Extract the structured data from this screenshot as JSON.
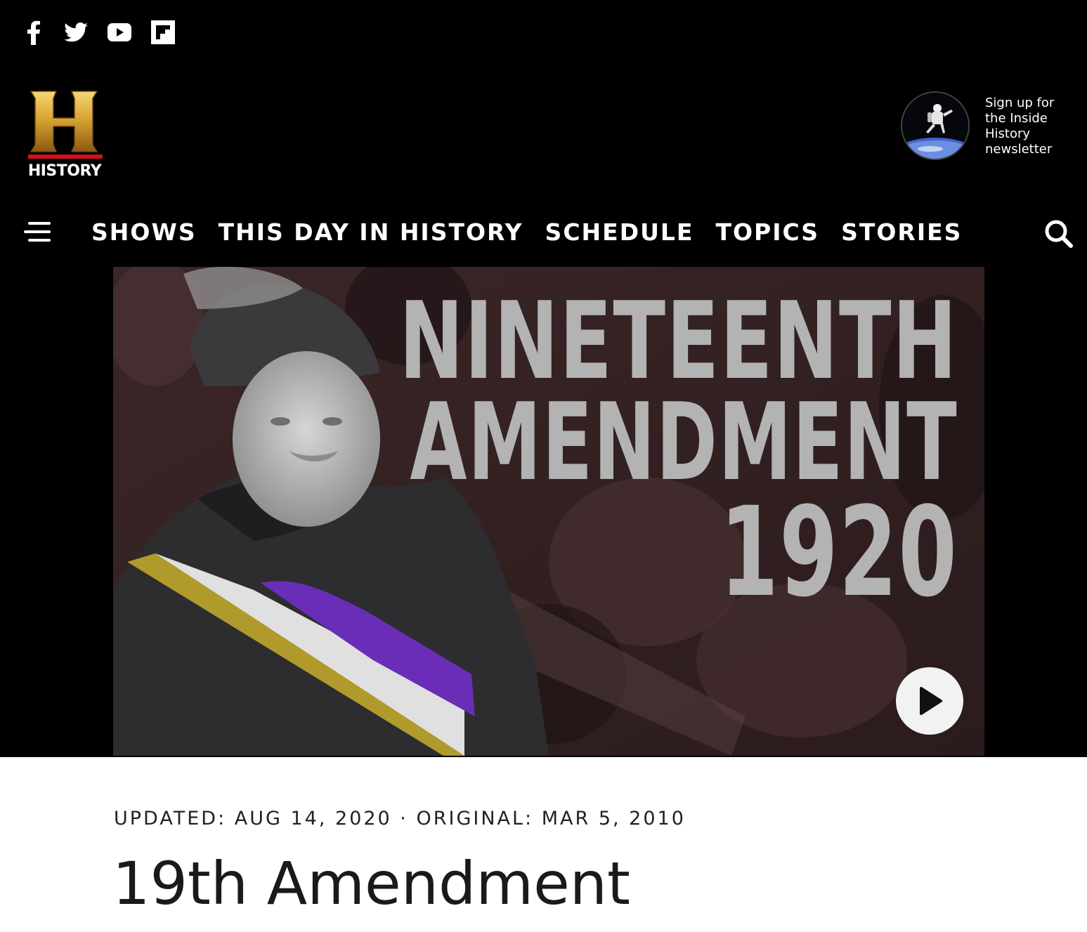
{
  "social": {
    "icons": [
      "facebook-icon",
      "twitter-icon",
      "youtube-icon",
      "flipboard-icon"
    ]
  },
  "brand": {
    "logo_text": "HISTORY",
    "logo_icon": "history-h-logo",
    "gold": "#d9a531",
    "red": "#d0121b"
  },
  "newsletter": {
    "text": "Sign up for the Inside History newsletter",
    "thumb_icon": "astronaut-thumbnail"
  },
  "nav": {
    "menu_icon": "hamburger-menu-icon",
    "items": [
      "SHOWS",
      "THIS DAY IN HISTORY",
      "SCHEDULE",
      "TOPICS",
      "STORIES"
    ],
    "search_icon": "search-icon"
  },
  "hero": {
    "title_line1": "NINETEENTH",
    "title_line2": "AMENDMENT",
    "title_line3": "1920",
    "play_icon": "play-icon",
    "sash_colors": [
      "#b09a2c",
      "#e0e0e0",
      "#6a2db8"
    ]
  },
  "article": {
    "meta": "UPDATED: AUG 14, 2020 · ORIGINAL: MAR 5, 2010",
    "title": "19th Amendment"
  }
}
